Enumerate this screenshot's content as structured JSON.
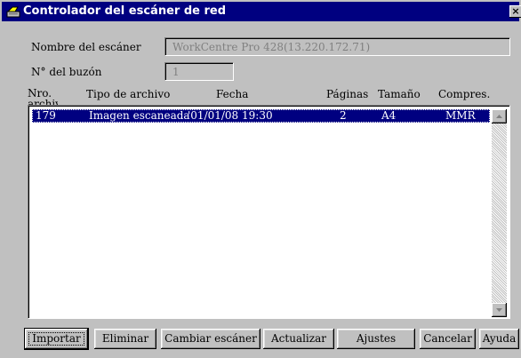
{
  "window": {
    "title": "Controlador del escáner de red",
    "close_glyph": "×"
  },
  "form": {
    "scanner_name_label": "Nombre del escáner",
    "scanner_name_value": "WorkCentre Pro 428(13.220.172.71)",
    "mailbox_label": "N° del buzón",
    "mailbox_value": "1"
  },
  "list": {
    "columns": [
      "Nro. archivo",
      "Tipo de archivo",
      "Fecha",
      "Páginas",
      "Tamaño",
      "Compres."
    ],
    "rows": [
      {
        "number": "179",
        "type": "Imagen escaneada",
        "date": "'01/01/08 19:30",
        "pages": "2",
        "size": "A4",
        "compression": "MMR",
        "selected": true
      }
    ]
  },
  "buttons": {
    "import": "Importar",
    "delete": "Eliminar",
    "change_scanner": "Cambiar escáner",
    "refresh": "Actualizar",
    "settings": "Ajustes",
    "cancel": "Cancelar",
    "help": "Ayuda"
  },
  "icons": {
    "title": "scanner-icon",
    "scroll_up": "arrow-up-icon",
    "scroll_down": "arrow-down-icon"
  }
}
